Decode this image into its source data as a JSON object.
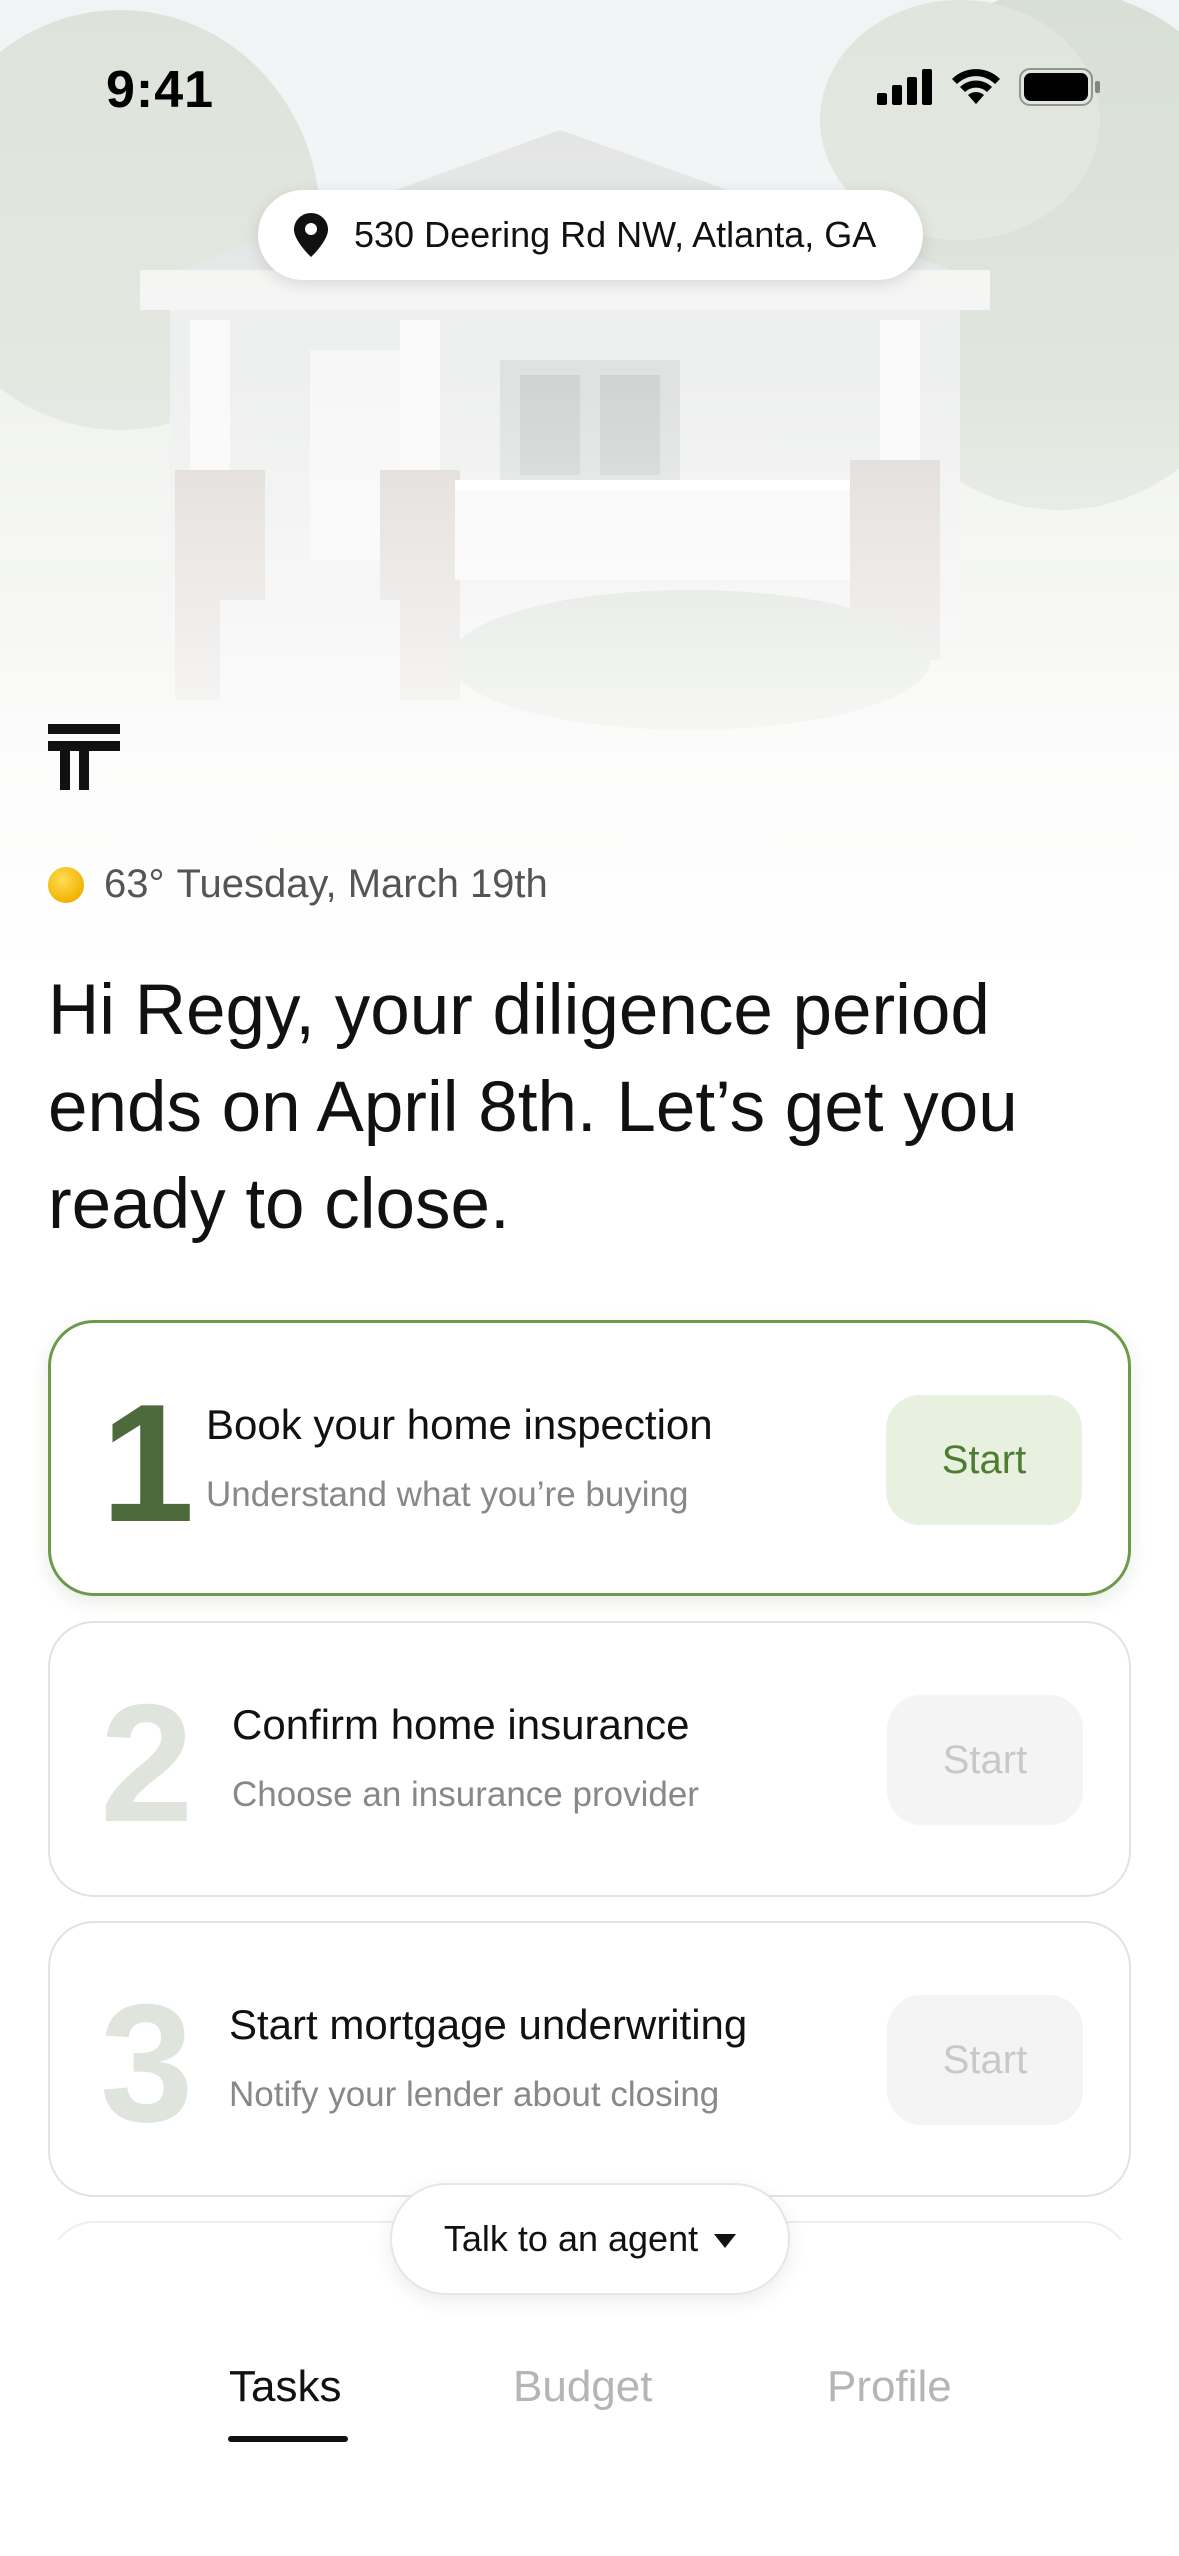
{
  "status_bar": {
    "time": "9:41"
  },
  "address": "530 Deering Rd NW, Atlanta, GA",
  "weather": {
    "temperature": "63°",
    "date": "Tuesday, March 19th"
  },
  "greeting": "Hi Regy, your diligence period ends on April 8th. Let’s get you ready to close.",
  "tasks": [
    {
      "number": "1",
      "title": "Book your home inspection",
      "subtitle": "Understand what you’re buying",
      "button": "Start",
      "active": true
    },
    {
      "number": "2",
      "title": "Confirm home insurance",
      "subtitle": "Choose an insurance provider",
      "button": "Start",
      "active": false
    },
    {
      "number": "3",
      "title": "Start mortgage underwriting",
      "subtitle": "Notify your lender about closing",
      "button": "Start",
      "active": false
    }
  ],
  "agent_button": "Talk to an agent",
  "tabs": [
    {
      "label": "Tasks",
      "active": true
    },
    {
      "label": "Budget",
      "active": false
    },
    {
      "label": "Profile",
      "active": false
    }
  ],
  "colors": {
    "accent": "#6a9a4a",
    "accent_dark": "#4d6a3c",
    "button_bg": "#e8f0e0"
  }
}
